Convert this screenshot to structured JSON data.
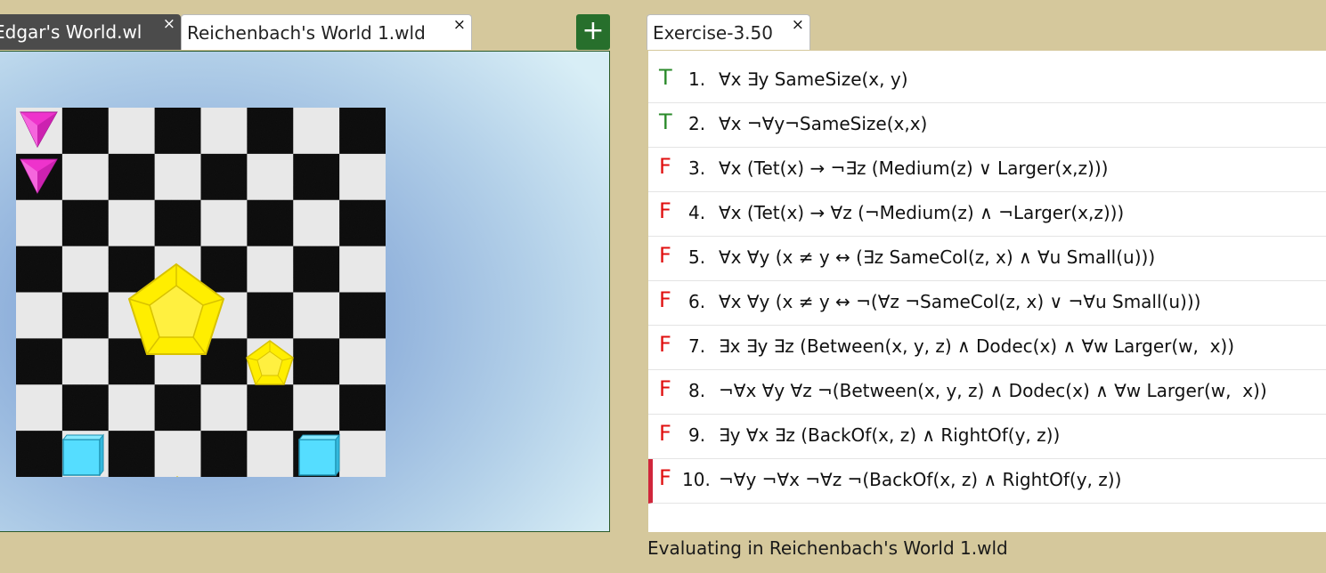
{
  "world_tabs": [
    {
      "label": "Edgar's World.wl",
      "close": "×"
    },
    {
      "label": "Reichenbach's World 1.wld",
      "close": "×"
    }
  ],
  "add_tab_label": "+",
  "sentence_tab": {
    "label": "Exercise-3.50",
    "close": "×"
  },
  "colors": {
    "true": "#2a8a2a",
    "false": "#e01010",
    "tet": "#ee33cc",
    "dodec": "#ffee00",
    "cube": "#55ddff"
  },
  "sentences": [
    {
      "truth": "T",
      "number": "1.",
      "formula": "∀x ∃y SameSize(x, y)"
    },
    {
      "truth": "T",
      "number": "2.",
      "formula": "∀x ¬∀y¬SameSize(x,x)"
    },
    {
      "truth": "F",
      "number": "3.",
      "formula": "∀x (Tet(x) → ¬∃z (Medium(z) ∨ Larger(x,z)))"
    },
    {
      "truth": "F",
      "number": "4.",
      "formula": "∀x (Tet(x) → ∀z (¬Medium(z) ∧ ¬Larger(x,z)))"
    },
    {
      "truth": "F",
      "number": "5.",
      "formula": "∀x ∀y (x ≠ y ↔ (∃z SameCol(z, x) ∧ ∀u Small(u)))"
    },
    {
      "truth": "F",
      "number": "6.",
      "formula": "∀x ∀y (x ≠ y ↔ ¬(∀z ¬SameCol(z, x) ∨ ¬∀u Small(u)))"
    },
    {
      "truth": "F",
      "number": "7.",
      "formula": "∃x ∃y ∃z (Between(x, y, z) ∧ Dodec(x) ∧ ∀w Larger(w,  x))"
    },
    {
      "truth": "F",
      "number": "8.",
      "formula": "¬∀x ∀y ∀z ¬(Between(x, y, z) ∧ Dodec(x) ∧ ∀w Larger(w,  x))"
    },
    {
      "truth": "F",
      "number": "9.",
      "formula": "∃y ∀x ∃z (BackOf(x, z) ∧ RightOf(y, z))"
    },
    {
      "truth": "F",
      "number": "10.",
      "formula": "¬∀y ¬∀x ¬∀z ¬(BackOf(x, z) ∧ RightOf(y, z))"
    }
  ],
  "status": "Evaluating in Reichenbach's World 1.wld"
}
